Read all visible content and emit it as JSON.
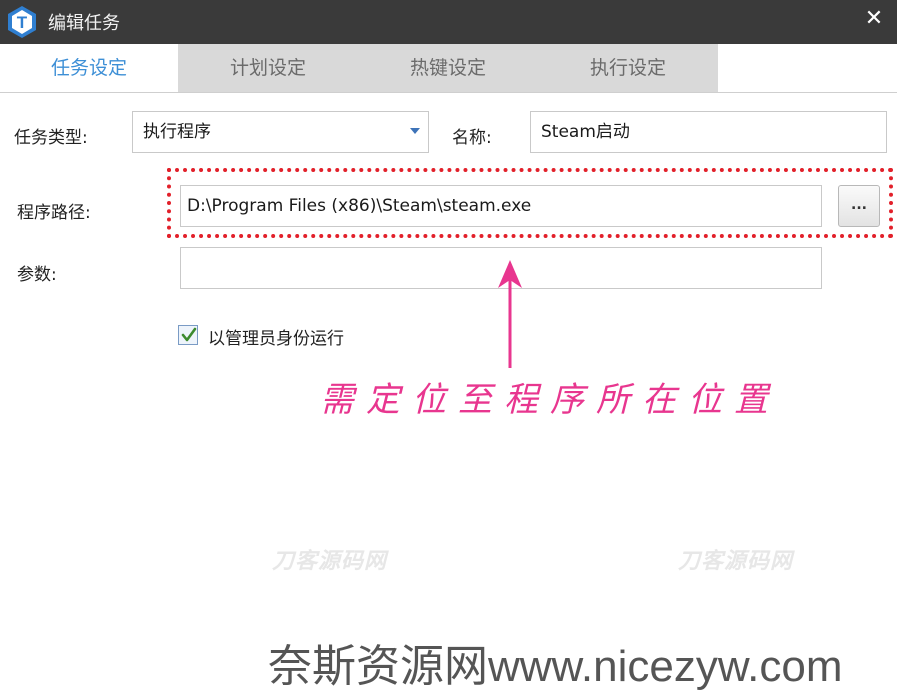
{
  "window": {
    "title": "编辑任务",
    "close_glyph": "✕",
    "logo_letter": "T"
  },
  "tabs": [
    {
      "label": "任务设定",
      "active": true
    },
    {
      "label": "计划设定",
      "active": false
    },
    {
      "label": "热键设定",
      "active": false
    },
    {
      "label": "执行设定",
      "active": false
    }
  ],
  "form": {
    "task_type_label": "任务类型:",
    "task_type_value": "执行程序",
    "name_label": "名称:",
    "name_value": "Steam启动",
    "path_label": "程序路径:",
    "path_value": "D:\\Program Files (x86)\\Steam\\steam.exe",
    "browse_label": "...",
    "params_label": "参数:",
    "params_value": "",
    "run_as_admin_label": "以管理员身份运行",
    "run_as_admin_checked": true
  },
  "annotation": {
    "text": "需定位至程序所在位置",
    "color": "#e8368f"
  },
  "watermarks": {
    "mark": "刀客源码网",
    "footer": "奈斯资源网www.nicezyw.com"
  },
  "colors": {
    "titlebar": "#3a3a3a",
    "tab_active_text": "#3d8fd6",
    "highlight_border": "#e2202a"
  },
  "icons": [
    "app-logo-icon",
    "close-icon",
    "dropdown-caret-icon",
    "checkmark-icon",
    "arrow-up-icon"
  ]
}
